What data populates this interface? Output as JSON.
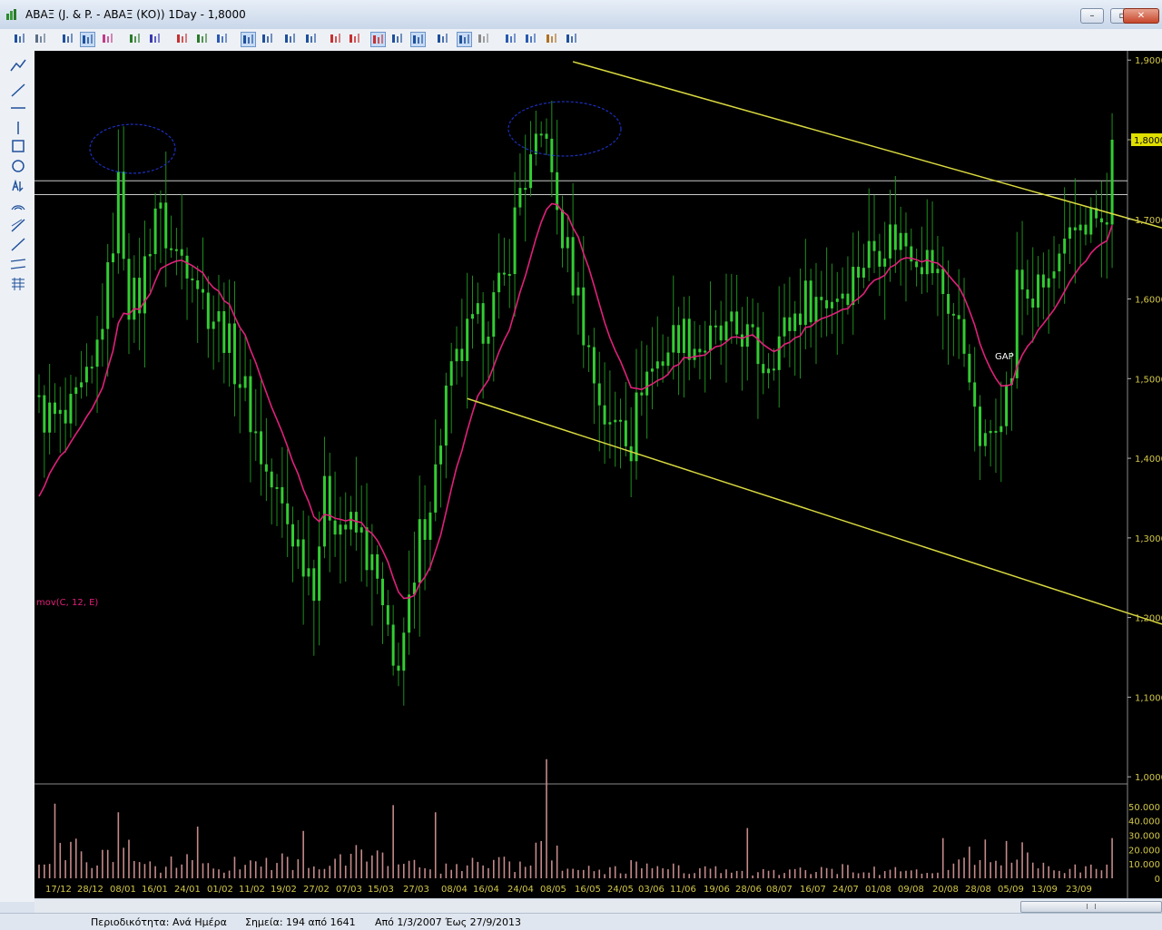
{
  "window": {
    "title": "ΑΒΑΞ (J. & P. - ΑΒΑΞ (ΚΟ)) 1Day - 1,8000",
    "buttons": {
      "minimize": "–",
      "restore": "▫",
      "close": "✕"
    }
  },
  "toolbar": {
    "icons": [
      "save-icon",
      "print-icon",
      "line-chart-icon",
      "bar-chart-icon",
      "refresh-icon",
      "indicator-icon",
      "compare-icon",
      "zoom-fit-icon",
      "zoom-in-icon",
      "zoom-out-icon",
      "move-left-icon",
      "move-right-icon",
      "scroll-start-icon",
      "scroll-end-icon",
      "marker-icon",
      "period-icon",
      "cursor-icon",
      "crosshair-icon",
      "volume-icon",
      "trend-icon",
      "network-icon",
      "window-icon",
      "layout-icon",
      "tools-icon",
      "report-icon",
      "export-icon"
    ]
  },
  "drawing_tools": [
    "trend-line-icon",
    "horizontal-line-icon",
    "vertical-line-icon",
    "rectangle-icon",
    "ellipse-icon",
    "text-tool-icon",
    "arc-icon",
    "fibonacci-icon",
    "ray-icon",
    "channel-icon",
    "grid-icon",
    "fan-icon"
  ],
  "chart_data": {
    "type": "bar",
    "price_axis": {
      "min": 1.05,
      "max": 1.9,
      "ticks": [
        "1,9000",
        "1,8000",
        "1,7000",
        "1,6000",
        "1,5000",
        "1,4000",
        "1,3000",
        "1,2000",
        "1,1000",
        "1,0000"
      ],
      "current_value": "1,8000"
    },
    "volume_axis": {
      "ticks": [
        "50.000",
        "40.000",
        "30.000",
        "20.000",
        "10.000",
        "0"
      ],
      "max": 55000
    },
    "x_labels": [
      "17/12",
      "28/12",
      "08/01",
      "16/01",
      "24/01",
      "01/02",
      "11/02",
      "19/02",
      "27/02",
      "07/03",
      "15/03",
      "27/03",
      "08/04",
      "16/04",
      "24/04",
      "08/05",
      "16/05",
      "24/05",
      "03/06",
      "11/06",
      "19/06",
      "28/06",
      "08/07",
      "16/07",
      "24/07",
      "01/08",
      "09/08",
      "20/08",
      "28/08",
      "05/09",
      "13/09",
      "23/09"
    ],
    "indicator_label": "mov(C, 12, E)",
    "annotation": "GAP",
    "close_anchors": [
      [
        0,
        1.46
      ],
      [
        5,
        1.44
      ],
      [
        10,
        1.5
      ],
      [
        13,
        1.62
      ],
      [
        15,
        1.74
      ],
      [
        17,
        1.6
      ],
      [
        19,
        1.6
      ],
      [
        22,
        1.72
      ],
      [
        25,
        1.66
      ],
      [
        29,
        1.65
      ],
      [
        31,
        1.6
      ],
      [
        35,
        1.56
      ],
      [
        39,
        1.48
      ],
      [
        43,
        1.38
      ],
      [
        47,
        1.32
      ],
      [
        52,
        1.25
      ],
      [
        54,
        1.35
      ],
      [
        57,
        1.32
      ],
      [
        61,
        1.3
      ],
      [
        64,
        1.24
      ],
      [
        67,
        1.13
      ],
      [
        69,
        1.18
      ],
      [
        71,
        1.23
      ],
      [
        72,
        1.3
      ],
      [
        75,
        1.38
      ],
      [
        77,
        1.48
      ],
      [
        81,
        1.55
      ],
      [
        85,
        1.58
      ],
      [
        88,
        1.62
      ],
      [
        91,
        1.74
      ],
      [
        94,
        1.78
      ],
      [
        96,
        1.82
      ],
      [
        97,
        1.74
      ],
      [
        99,
        1.68
      ],
      [
        102,
        1.6
      ],
      [
        105,
        1.5
      ],
      [
        108,
        1.43
      ],
      [
        110,
        1.46
      ],
      [
        112,
        1.42
      ],
      [
        114,
        1.5
      ],
      [
        117,
        1.52
      ],
      [
        121,
        1.56
      ],
      [
        125,
        1.54
      ],
      [
        129,
        1.55
      ],
      [
        133,
        1.56
      ],
      [
        137,
        1.52
      ],
      [
        141,
        1.56
      ],
      [
        145,
        1.6
      ],
      [
        149,
        1.6
      ],
      [
        153,
        1.62
      ],
      [
        157,
        1.66
      ],
      [
        161,
        1.68
      ],
      [
        165,
        1.67
      ],
      [
        169,
        1.64
      ],
      [
        173,
        1.58
      ],
      [
        176,
        1.52
      ],
      [
        177,
        1.44
      ],
      [
        179,
        1.41
      ],
      [
        181,
        1.46
      ],
      [
        183,
        1.48
      ],
      [
        184,
        1.51
      ],
      [
        185,
        1.62
      ],
      [
        188,
        1.6
      ],
      [
        191,
        1.62
      ],
      [
        194,
        1.65
      ],
      [
        197,
        1.7
      ],
      [
        200,
        1.7
      ],
      [
        202,
        1.68
      ],
      [
        203,
        1.8
      ]
    ],
    "volume_anchors": [
      [
        0,
        10000
      ],
      [
        4,
        16000
      ],
      [
        8,
        26000
      ],
      [
        10,
        14000
      ],
      [
        15,
        22000
      ],
      [
        22,
        9000
      ],
      [
        28,
        11000
      ],
      [
        35,
        7000
      ],
      [
        41,
        16000
      ],
      [
        48,
        11000
      ],
      [
        55,
        8000
      ],
      [
        62,
        19000
      ],
      [
        66,
        14000
      ],
      [
        70,
        9000
      ],
      [
        74,
        6000
      ],
      [
        80,
        8000
      ],
      [
        86,
        11000
      ],
      [
        92,
        10000
      ],
      [
        96,
        22000
      ],
      [
        100,
        7000
      ],
      [
        106,
        5000
      ],
      [
        112,
        8000
      ],
      [
        118,
        10000
      ],
      [
        124,
        6000
      ],
      [
        130,
        5000
      ],
      [
        136,
        4000
      ],
      [
        142,
        5000
      ],
      [
        148,
        5000
      ],
      [
        154,
        7000
      ],
      [
        160,
        5000
      ],
      [
        166,
        5000
      ],
      [
        172,
        4000
      ],
      [
        176,
        14000
      ],
      [
        180,
        10000
      ],
      [
        184,
        22000
      ],
      [
        188,
        12000
      ],
      [
        194,
        6000
      ],
      [
        200,
        7000
      ],
      [
        203,
        22000
      ]
    ],
    "volume_spikes": [
      [
        3,
        52000
      ],
      [
        15,
        46000
      ],
      [
        30,
        36000
      ],
      [
        50,
        33000
      ],
      [
        67,
        51000
      ],
      [
        75,
        46000
      ],
      [
        96,
        83000
      ],
      [
        134,
        35000
      ],
      [
        171,
        28000
      ],
      [
        176,
        22000
      ],
      [
        179,
        27000
      ],
      [
        183,
        26000
      ],
      [
        203,
        28000
      ]
    ],
    "horizontal_levels": [
      1.7485,
      1.731
    ],
    "resistance_line": [
      [
        101,
        1.898
      ],
      [
        203,
        1.707
      ]
    ],
    "support_line": [
      [
        81,
        1.475
      ],
      [
        203,
        1.212
      ]
    ]
  },
  "status": {
    "period": "Περιοδικότητα: Ανά Ημέρα",
    "points": "Σημεία: 194 από 1641",
    "range": "Από 1/3/2007  Έως 27/9/2013"
  }
}
